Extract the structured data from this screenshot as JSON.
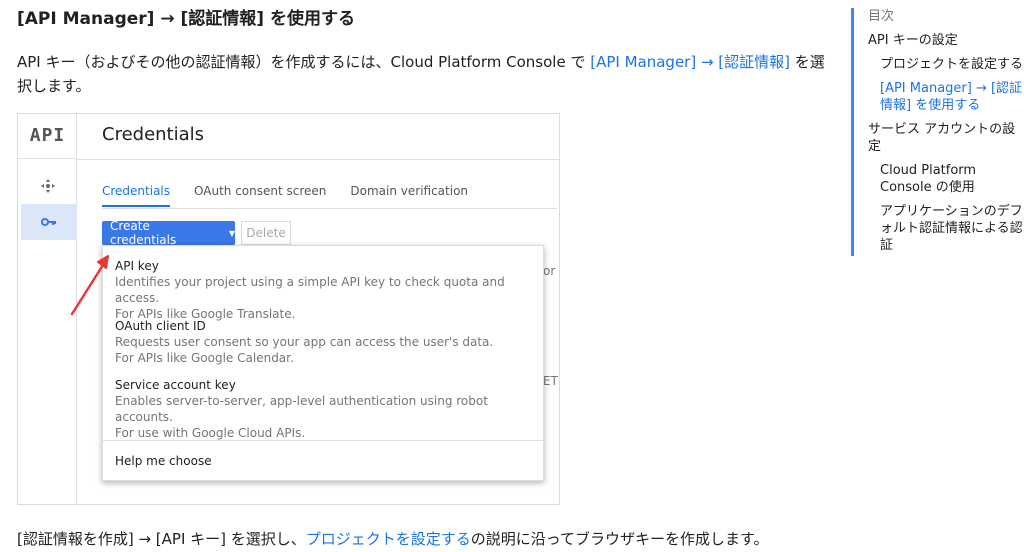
{
  "doc": {
    "heading": "[API Manager] → [認証情報] を使用する",
    "para_prefix": "API キー（およびその他の認証情報）を作成するには、Cloud Platform Console で ",
    "para_link": "[API Manager] → [認証情報]",
    "para_suffix": " を選択します。",
    "bottom_prefix": "[認証情報を作成] → [API キー] を選択し、",
    "bottom_link": "プロジェクトを設定する",
    "bottom_suffix": "の説明に沿ってブラウザキーを作成します。"
  },
  "console": {
    "logo": "API",
    "page_title": "Credentials",
    "tabs": [
      "Credentials",
      "OAuth consent screen",
      "Domain verification"
    ],
    "create_label": "Create credentials",
    "delete_label": "Delete",
    "bg_fragment_1": "or",
    "bg_fragment_2": "ET",
    "menu": {
      "items": [
        {
          "title": "API key",
          "desc1": "Identifies your project using a simple API key to check quota and access.",
          "desc2": "For APIs like Google Translate."
        },
        {
          "title": "OAuth client ID",
          "desc1": "Requests user consent so your app can access the user's data.",
          "desc2": "For APIs like Google Calendar."
        },
        {
          "title": "Service account key",
          "desc1": "Enables server-to-server, app-level authentication using robot accounts.",
          "desc2": "For use with Google Cloud APIs."
        }
      ],
      "help": "Help me choose"
    },
    "annotation_color": "#e53935"
  },
  "toc": {
    "title": "目次",
    "items": [
      {
        "label": "API キーの設定"
      },
      {
        "label": "プロジェクトを設定する"
      },
      {
        "label": "[API Manager] → [認証情報] を使用する"
      },
      {
        "label": "サービス アカウントの設定"
      },
      {
        "label": "Cloud Platform Console の使用"
      },
      {
        "label": "アプリケーションのデフォルト認証情報による認証"
      }
    ]
  },
  "colors": {
    "link": "#1a73e8",
    "toc_bar": "#4285f4",
    "primary_button": "#3b78e7"
  }
}
